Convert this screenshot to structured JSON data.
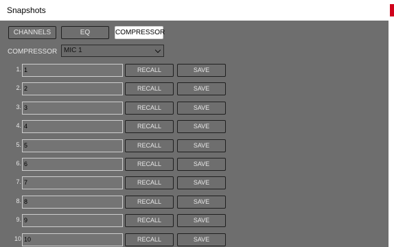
{
  "window": {
    "title": "Snapshots",
    "accent_color": "#d0021b"
  },
  "tabs": [
    {
      "label": "CHANNELS",
      "active": false
    },
    {
      "label": "EQ",
      "active": false
    },
    {
      "label": "COMPRESSOR",
      "active": true
    }
  ],
  "compressor": {
    "label": "COMPRESSOR",
    "selected": "MIC 1"
  },
  "snapshots": [
    {
      "num": "1.",
      "value": "1",
      "recall": "RECALL",
      "save": "SAVE"
    },
    {
      "num": "2.",
      "value": "2",
      "recall": "RECALL",
      "save": "SAVE"
    },
    {
      "num": "3.",
      "value": "3",
      "recall": "RECALL",
      "save": "SAVE"
    },
    {
      "num": "4.",
      "value": "4",
      "recall": "RECALL",
      "save": "SAVE"
    },
    {
      "num": "5.",
      "value": "5",
      "recall": "RECALL",
      "save": "SAVE"
    },
    {
      "num": "6.",
      "value": "6",
      "recall": "RECALL",
      "save": "SAVE"
    },
    {
      "num": "7.",
      "value": "7",
      "recall": "RECALL",
      "save": "SAVE"
    },
    {
      "num": "8.",
      "value": "8",
      "recall": "RECALL",
      "save": "SAVE"
    },
    {
      "num": "9.",
      "value": "9",
      "recall": "RECALL",
      "save": "SAVE"
    },
    {
      "num": "10",
      "value": "10",
      "recall": "RECALL",
      "save": "SAVE"
    }
  ]
}
